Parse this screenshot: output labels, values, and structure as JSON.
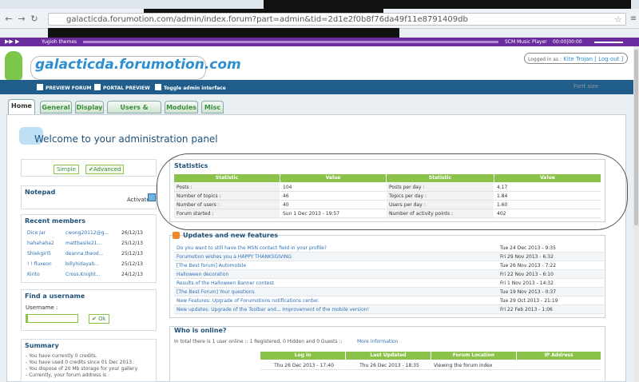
{
  "browser": {
    "url": "galacticda.forumotion.com/admin/index.forum?part=admin&tid=2d1",
    "url_tail": "e2f0b8f76da49f11e8791409db"
  },
  "music": {
    "theme_label": "Yugioh themes",
    "player_label": "SCM Music Player",
    "time": "00:00|00:00"
  },
  "header": {
    "logo": "galacticda.forumotion.com",
    "logged_prefix": "Logged in as :",
    "user": "Kite Trojan",
    "logout": "[ Log out ]"
  },
  "toolbar": {
    "preview_forum": "PREVIEW FORUM",
    "portal_preview": "PORTAL PREVIEW",
    "toggle": "Toggle admin interface",
    "font_size": "Font size"
  },
  "tabs": [
    "Home",
    "General",
    "Display",
    "Users & Groups",
    "Modules",
    "Misc"
  ],
  "welcome": "Welcome to your administration panel",
  "mode": {
    "simple": "Simple",
    "advanced": "Advanced"
  },
  "notepad": {
    "title": "Notepad",
    "activate": "Activate"
  },
  "recent": {
    "title": "Recent members",
    "rows": [
      [
        "Dice Jar",
        "cwong20112@g...",
        "26/12/13"
      ],
      [
        "hahahaha2",
        "mattbasile21...",
        "25/12/13"
      ],
      [
        "Shiekgirl5",
        "deanna.theod...",
        "25/12/13"
      ],
      [
        "! ! fluxeon",
        "billyhidayah...",
        "25/12/13"
      ],
      [
        "Kirito",
        "Cross.Knight...",
        "24/12/13"
      ]
    ]
  },
  "find": {
    "title": "Find a username",
    "label": "Username :",
    "ok": "Ok"
  },
  "summary": {
    "title": "Summary",
    "lines": [
      "- You have currently 0 credits.",
      "- You have used 0 credits since 01 Dec 2013 .",
      "- You dispose of 20 Mb storage for your gallery.",
      "- Currently, your forum address is :"
    ]
  },
  "stats": {
    "title": "Statistics",
    "headers": [
      "Statistic",
      "Value",
      "Statistic",
      "Value"
    ],
    "rows": [
      [
        "Posts :",
        "104",
        "Posts per day :",
        "4.17"
      ],
      [
        "Number of topics :",
        "46",
        "Topics per day :",
        "1.84"
      ],
      [
        "Number of users :",
        "40",
        "Users per day :",
        "1.60"
      ],
      [
        "Forum started :",
        "Sun 1 Dec 2013 - 19:57",
        "Number of activity points :",
        "402"
      ]
    ]
  },
  "updates": {
    "title": "Updates and new features",
    "rows": [
      [
        "Do you want to still have the MSN contact field in your profile?",
        "Tue 24 Dec 2013 - 9:35"
      ],
      [
        "Forumotion wishes you a HAPPY THANKSGIVING",
        "Fri 29 Nov 2013 - 6:32"
      ],
      [
        "[The Best forum] Automobile",
        "Tue 26 Nov 2013 - 7:22"
      ],
      [
        "Halloween decoration",
        "Fri 22 Nov 2013 - 6:10"
      ],
      [
        "Results of the Halloween Banner contest",
        "Fri 1 Nov 2013 - 14:32"
      ],
      [
        "[The Best Forum] Your questions",
        "Tue 19 Nov 2013 - 0:37"
      ],
      [
        "New Features: Upgrade of Forumotions notifications center.",
        "Tue 29 Oct 2013 - 21:19"
      ],
      [
        "New updates: Upgrade of the Toolbar and... Improvement of the mobile version!",
        "Fri 22 Feb 2013 - 1:06"
      ]
    ]
  },
  "who": {
    "title": "Who is online?",
    "summary": "In total there is 1 user online :: 1 Registered, 0 Hidden and 0 Guests :: ",
    "more": "More information",
    "headers": [
      "Log in",
      "Last Updated",
      "Forum Location",
      "IP Address"
    ],
    "row": [
      "Thu 26 Dec 2013 - 17:40",
      "Thu 26 Dec 2013 - 18:35",
      "Viewing the forum index",
      ""
    ]
  },
  "colors": {
    "green": "#8bc34a",
    "nav": "#1f5e8a",
    "purple": "#6a2c9e",
    "link": "#2f72b6"
  }
}
